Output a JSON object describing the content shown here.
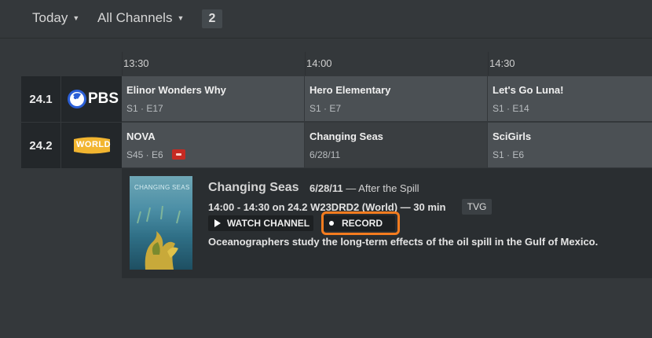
{
  "header": {
    "date_filter": "Today",
    "channel_filter": "All Channels",
    "count": "2"
  },
  "timeline": [
    "13:30",
    "14:00",
    "14:30"
  ],
  "channels": [
    {
      "number": "24.1",
      "logo": "PBS",
      "programs": [
        {
          "title": "Elinor Wonders Why",
          "episode": "S1 · E17"
        },
        {
          "title": "Hero Elementary",
          "episode": "S1 · E7"
        },
        {
          "title": "Let's Go Luna!",
          "episode": "S1 · E14"
        }
      ]
    },
    {
      "number": "24.2",
      "logo": "WORLD",
      "programs": [
        {
          "title": "NOVA",
          "episode": "S45 · E6"
        },
        {
          "title": "Changing Seas",
          "episode": "6/28/11"
        },
        {
          "title": "SciGirls",
          "episode": "S1 · E6"
        }
      ]
    }
  ],
  "detail": {
    "poster_text": "CHANGING SEAS",
    "title": "Changing Seas",
    "date": "6/28/11",
    "episode_title": "— After the Spill",
    "schedule": "14:00 - 14:30 on 24.2 W23DRD2 (World) — 30 min",
    "rating": "TVG",
    "watch_label": "WATCH CHANNEL",
    "record_label": "RECORD",
    "description": "Oceanographers study the long-term effects of the oil spill in the Gulf of Mexico."
  },
  "colors": {
    "record_highlight": "#f57c1f",
    "recording_indicator": "#c62a22",
    "background": "#34383b"
  }
}
